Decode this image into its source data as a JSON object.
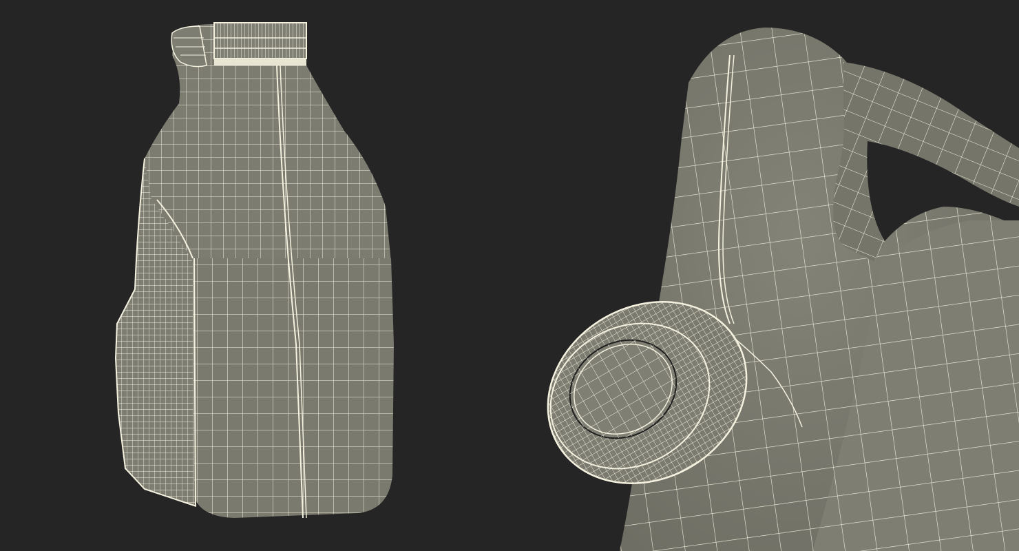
{
  "scene": {
    "background_color": "#252525",
    "surface_color": "#7b7b70",
    "surface_shadow_color": "#5e5e56",
    "wire_color": "#f4f1df",
    "views": [
      {
        "name": "front-view",
        "subject": "wireframe-bottle"
      },
      {
        "name": "closeup-view",
        "subject": "wireframe-bottle-cap-and-handle"
      }
    ]
  }
}
